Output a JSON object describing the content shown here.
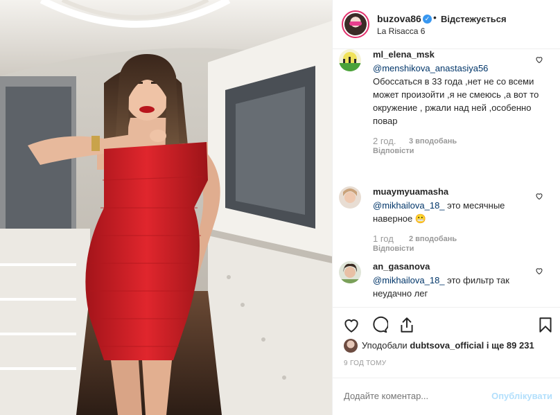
{
  "post": {
    "username": "buzova86",
    "follow_status": "Відстежується",
    "location": "La Risacca 6"
  },
  "comments": [
    {
      "username": "ml_elena_msk",
      "mention": "@menshikova_anastasiya56",
      "text": "Обоссаться в 33 года ,нет не со всеми может произойти ,я не смеюсь ,а вот то окружение , ржали над ней ,особенно повар",
      "time": "2 год.",
      "likes": "3 вподобань",
      "reply": "Відповісти"
    },
    {
      "username": "muaymyuamasha",
      "mention": "@mikhailova_18_",
      "text": "это месячные наверное 😬",
      "time": "1 год",
      "likes": "2 вподобань",
      "reply": "Відповісти"
    },
    {
      "username": "an_gasanova",
      "mention": "@mikhailova_18_",
      "text": "это фильтр так неудачно лег"
    }
  ],
  "actions": {
    "like_icon": "heart-icon",
    "comment_icon": "comment-icon",
    "share_icon": "share-icon",
    "save_icon": "bookmark-icon"
  },
  "likes": {
    "prefix": "Уподобали",
    "user": "dubtsova_official",
    "suffix": "і ще 89 231"
  },
  "timestamp": "9 ГОД ТОМУ",
  "add_comment": {
    "placeholder": "Додайте коментар...",
    "publish_label": "Опублікувати"
  },
  "colors": {
    "accent": "#3897f0",
    "publish_disabled": "#b2dffc",
    "dress": "#d61f26"
  }
}
